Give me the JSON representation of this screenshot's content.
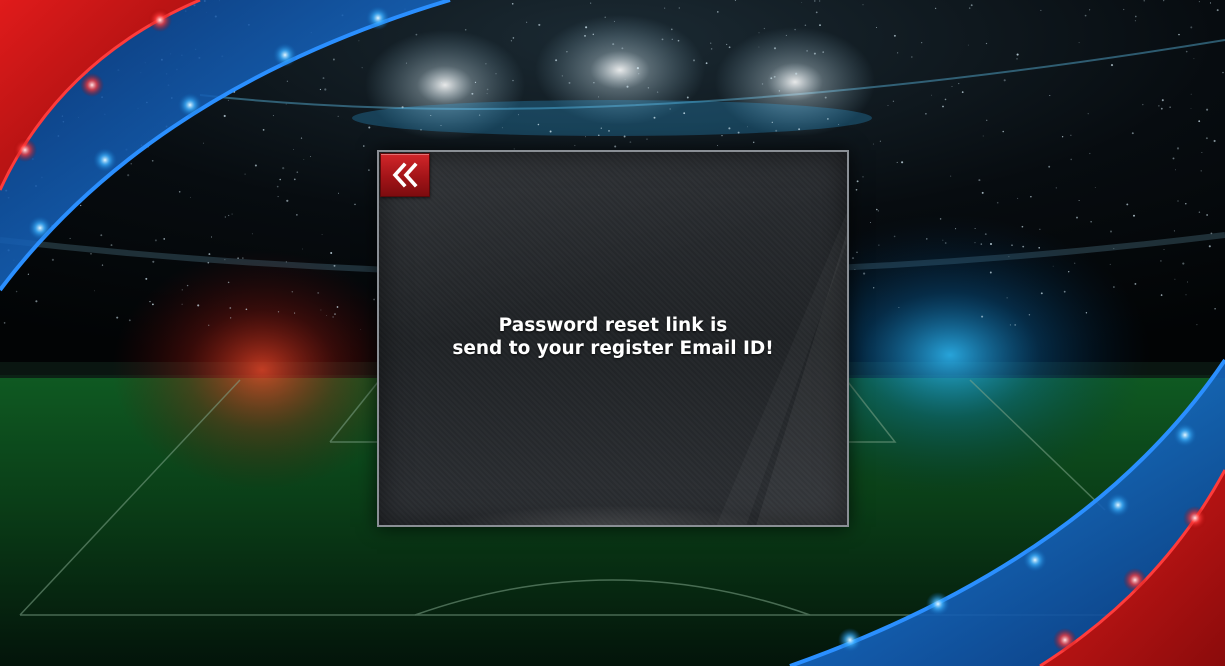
{
  "dialog": {
    "message_line1": "Password reset link is",
    "message_line2": "send to your register Email ID!",
    "back_icon": "double-chevron-left-icon"
  },
  "colors": {
    "accent_red": "#c31c20",
    "ribbon_blue": "#1565c0",
    "pitch_green": "#0d4a1c",
    "dialog_bg": "#24272a",
    "dialog_border": "#8a8f95"
  }
}
